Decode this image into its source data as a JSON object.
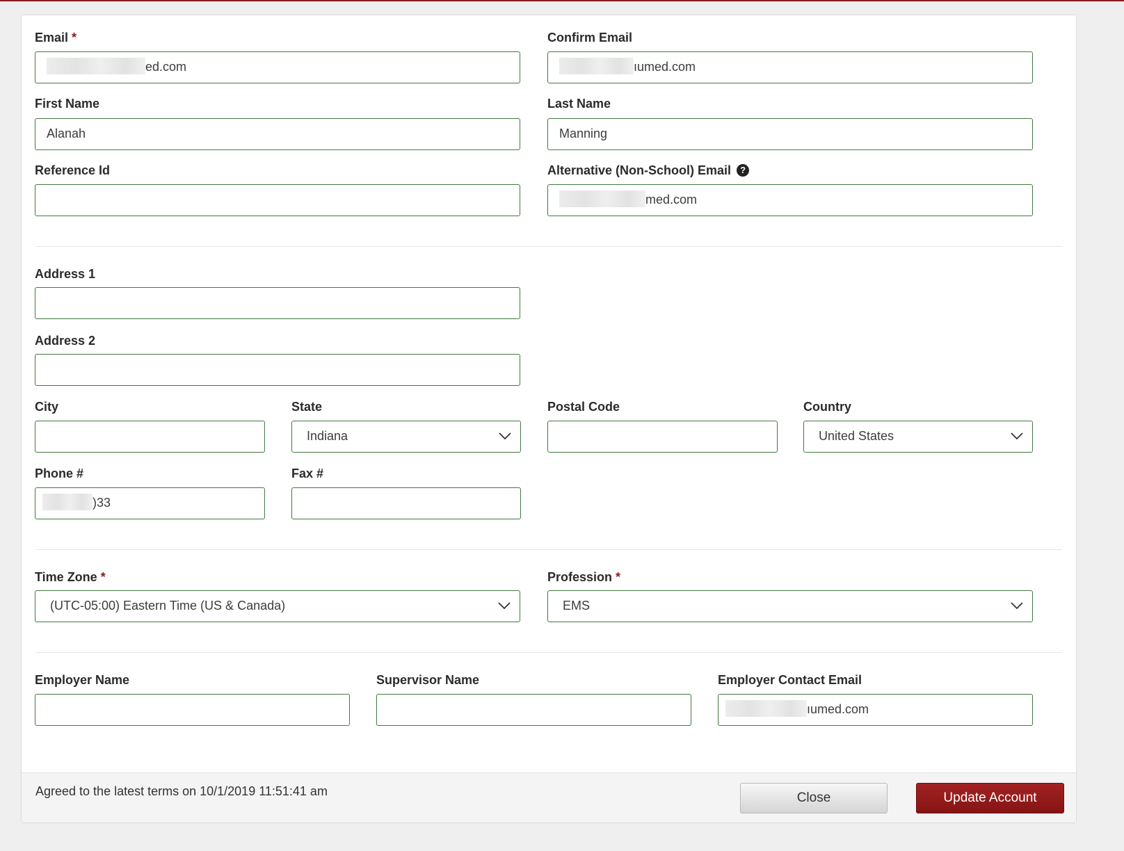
{
  "form": {
    "email": {
      "label": "Email",
      "required": "*",
      "value_suffix": "ed.com"
    },
    "confirm_email": {
      "label": "Confirm Email",
      "value_suffix": "ıumed.com"
    },
    "first_name": {
      "label": "First Name",
      "value": "Alanah"
    },
    "last_name": {
      "label": "Last Name",
      "value": "Manning"
    },
    "reference_id": {
      "label": "Reference Id",
      "value": ""
    },
    "alt_email": {
      "label": "Alternative (Non-School) Email",
      "help_icon": "?",
      "value_suffix": "med.com"
    },
    "address1": {
      "label": "Address 1",
      "value": ""
    },
    "address2": {
      "label": "Address 2",
      "value": ""
    },
    "city": {
      "label": "City",
      "value": ""
    },
    "state": {
      "label": "State",
      "value": "Indiana"
    },
    "postal_code": {
      "label": "Postal Code",
      "value": ""
    },
    "country": {
      "label": "Country",
      "value": "United States"
    },
    "phone": {
      "label": "Phone #",
      "value_suffix": ")33"
    },
    "fax": {
      "label": "Fax #",
      "value": ""
    },
    "time_zone": {
      "label": "Time Zone",
      "required": "*",
      "value": "(UTC-05:00) Eastern Time (US & Canada)"
    },
    "profession": {
      "label": "Profession",
      "required": "*",
      "value": "EMS"
    },
    "employer_name": {
      "label": "Employer Name",
      "value": ""
    },
    "supervisor_name": {
      "label": "Supervisor Name",
      "value": ""
    },
    "employer_contact_email": {
      "label": "Employer Contact Email",
      "value_suffix": "ıumed.com"
    }
  },
  "footer": {
    "terms_text": "Agreed to the latest terms on 10/1/2019 11:51:41 am",
    "close_label": "Close",
    "update_label": "Update Account"
  },
  "colors": {
    "accent": "#8b1a1a",
    "field_border": "#3f7a3f",
    "button_primary": "#931b1b"
  },
  "icons": {
    "help": "question-circle-icon",
    "dropdown": "chevron-down-icon"
  }
}
